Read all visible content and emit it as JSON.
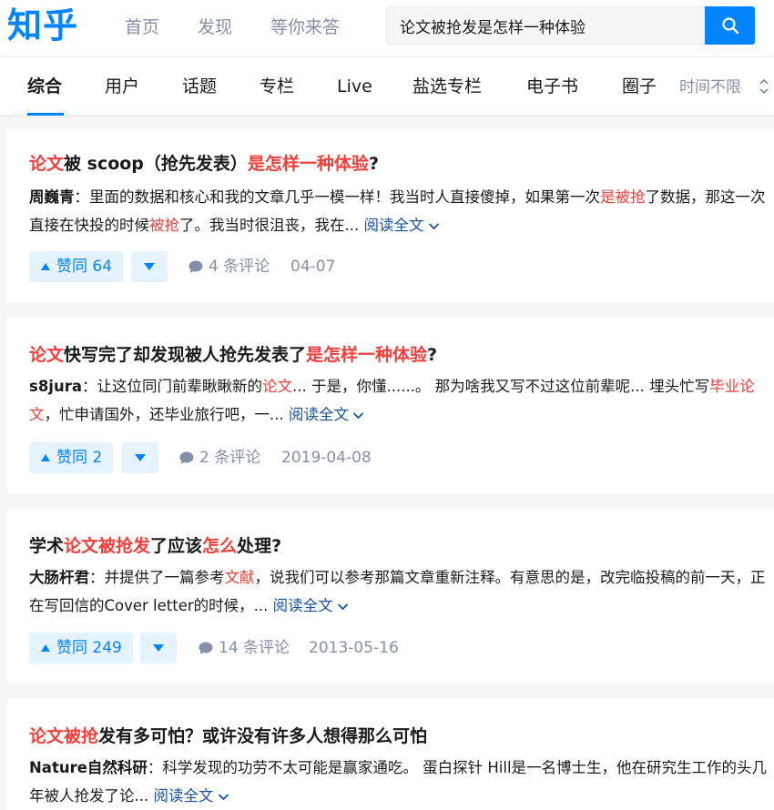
{
  "header": {
    "logo": "知乎",
    "nav": [
      "首页",
      "发现",
      "等你来答"
    ],
    "search_value": "论文被抢发是怎样一种体验",
    "brand_color": "#0084ff"
  },
  "tabs": {
    "items": [
      "综合",
      "用户",
      "话题",
      "专栏",
      "Live",
      "盐选专栏",
      "电子书",
      "圈子"
    ],
    "active": "综合",
    "time_filter": "时间不限"
  },
  "results": [
    {
      "title": [
        {
          "t": "论文",
          "hl": true
        },
        {
          "t": "被 scoop（抢先发表）",
          "hl": false
        },
        {
          "t": "是怎样一种体验",
          "hl": true
        },
        {
          "t": "?",
          "hl": false
        }
      ],
      "author": "周巍青",
      "excerpt": [
        {
          "t": "：里面的数据和核心和我的文章几乎一模一样！我当时人直接傻掉，如果第一次",
          "hl": false
        },
        {
          "t": "是被抢",
          "hl": true
        },
        {
          "t": "了数据，那这一次直接在快投的时候",
          "hl": false
        },
        {
          "t": "被抢",
          "hl": true
        },
        {
          "t": "了。我当时很沮丧，我在...",
          "hl": false
        }
      ],
      "read_more": "阅读全文",
      "votes": "赞同 64",
      "comments": "4 条评论",
      "date": "04-07"
    },
    {
      "title": [
        {
          "t": "论文",
          "hl": true
        },
        {
          "t": "快写完了却发现被人抢先发表了",
          "hl": false
        },
        {
          "t": "是怎样一种体验",
          "hl": true
        },
        {
          "t": "?",
          "hl": false
        }
      ],
      "author": "s8jura",
      "excerpt": [
        {
          "t": "：让这位同门前辈瞅瞅新的",
          "hl": false
        },
        {
          "t": "论文",
          "hl": true
        },
        {
          "t": "... 于是，你懂......。 那为啥我又写不过这位前辈呢... 埋头忙写",
          "hl": false
        },
        {
          "t": "毕业论文",
          "hl": true
        },
        {
          "t": "，忙申请国外，还毕业旅行吧，一...",
          "hl": false
        }
      ],
      "read_more": "阅读全文",
      "votes": "赞同 2",
      "comments": "2 条评论",
      "date": "2019-04-08"
    },
    {
      "title": [
        {
          "t": "学术",
          "hl": false
        },
        {
          "t": "论文被抢发",
          "hl": true
        },
        {
          "t": "了应该",
          "hl": false
        },
        {
          "t": "怎么",
          "hl": true
        },
        {
          "t": "处理?",
          "hl": false
        }
      ],
      "author": "大肠杆君",
      "excerpt": [
        {
          "t": "：并提供了一篇参考",
          "hl": false
        },
        {
          "t": "文献",
          "hl": true
        },
        {
          "t": "，说我们可以参考那篇文章重新注释。有意思的是，改完临投稿的前一天，正在写回信的Cover letter的时候，...",
          "hl": false
        }
      ],
      "read_more": "阅读全文",
      "votes": "赞同 249",
      "comments": "14 条评论",
      "date": "2013-05-16"
    },
    {
      "title": [
        {
          "t": "论文被抢",
          "hl": true
        },
        {
          "t": "发有多可怕？或许没有许多人想得那么可怕",
          "hl": false
        }
      ],
      "author": "Nature自然科研",
      "excerpt": [
        {
          "t": "：科学发现的功劳不太可能是赢家通吃。 蛋白探针 Hill是一名博士生，他在研究生工作的头几年被人抢发了论...",
          "hl": false
        }
      ],
      "read_more": "阅读全文"
    }
  ]
}
